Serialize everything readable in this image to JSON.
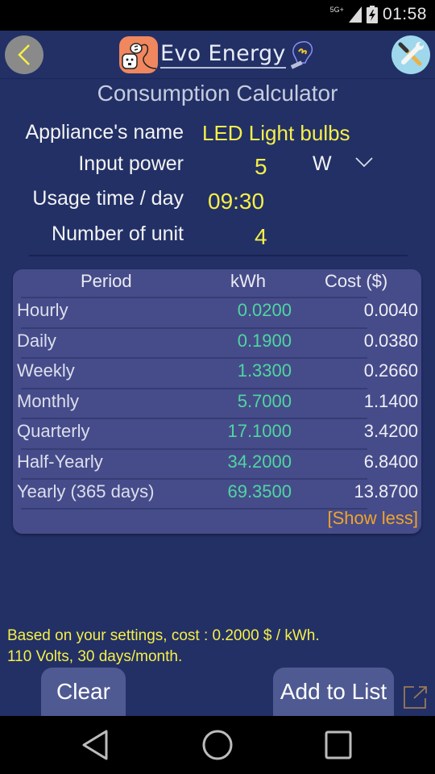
{
  "status_bar": {
    "network": "5G+",
    "time": "01:58"
  },
  "header": {
    "app_name": "Evo Energy",
    "back_icon": "chevron-left-icon",
    "tools_icon": "wrench-screwdriver-icon",
    "accent_color": "#f6ef48"
  },
  "page_title": "Consumption Calculator",
  "form": {
    "appliance_label": "Appliance's name",
    "appliance_value": "LED Light bulbs",
    "power_label": "Input power",
    "power_value": "5",
    "power_unit": "W",
    "usage_label": "Usage time / day",
    "usage_value": "09:30",
    "units_label": "Number of unit",
    "units_value": "4"
  },
  "table": {
    "headers": [
      "Period",
      "kWh",
      "Cost ($)"
    ],
    "rows": [
      {
        "period": "Hourly",
        "kwh": "0.0200",
        "cost": "0.0040"
      },
      {
        "period": "Daily",
        "kwh": "0.1900",
        "cost": "0.0380"
      },
      {
        "period": "Weekly",
        "kwh": "1.3300",
        "cost": "0.2660"
      },
      {
        "period": "Monthly",
        "kwh": "5.7000",
        "cost": "1.1400"
      },
      {
        "period": "Quarterly",
        "kwh": "17.1000",
        "cost": "3.4200"
      },
      {
        "period": "Half-Yearly",
        "kwh": "34.2000",
        "cost": "6.8400"
      },
      {
        "period": "Yearly (365 days)",
        "kwh": "69.3500",
        "cost": "13.8700"
      }
    ],
    "toggle_label": "[Show less]"
  },
  "footnote": {
    "line1": "Based on your settings, cost : 0.2000 $ / kWh.",
    "line2": "110 Volts, 30 days/month."
  },
  "actions": {
    "clear_label": "Clear",
    "add_label": "Add to List"
  },
  "nav": {
    "back": "back-triangle-icon",
    "home": "home-circle-icon",
    "recents": "recents-square-icon"
  }
}
